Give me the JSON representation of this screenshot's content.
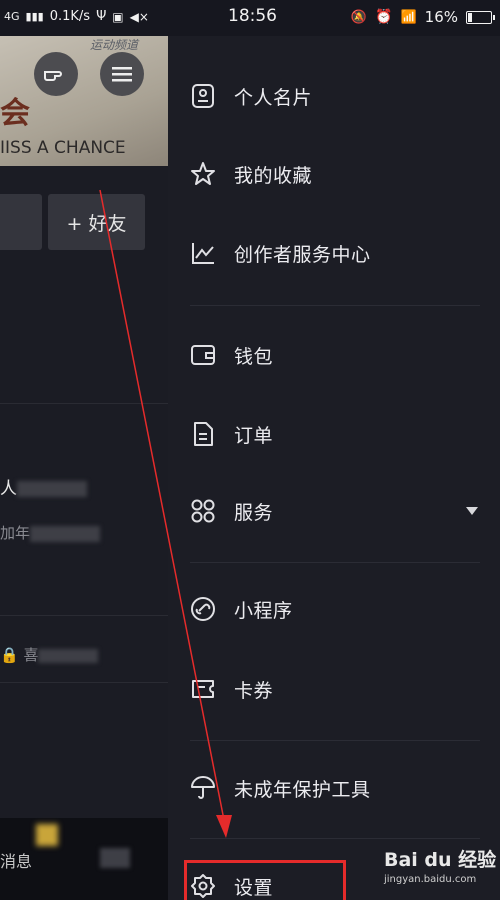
{
  "status_bar": {
    "network": "4G",
    "speed": "0.1K/s",
    "time": "18:56",
    "battery": "16%",
    "battery_level": 0.16
  },
  "left_page": {
    "watermark": "运动频道",
    "big_text": "会",
    "banner_text": "IISS A CHANCE",
    "friend_button": "+ 好友",
    "partial_1": "人",
    "partial_2": "加年",
    "partial_3": "喜",
    "partial_4": "消息"
  },
  "drawer": {
    "items": [
      {
        "label": "个人名片",
        "icon": "id-card-icon"
      },
      {
        "label": "我的收藏",
        "icon": "star-icon"
      },
      {
        "label": "创作者服务中心",
        "icon": "chart-icon"
      },
      {
        "label": "钱包",
        "icon": "wallet-icon"
      },
      {
        "label": "订单",
        "icon": "document-icon"
      },
      {
        "label": "服务",
        "icon": "grid-icon"
      },
      {
        "label": "小程序",
        "icon": "link-icon"
      },
      {
        "label": "卡券",
        "icon": "ticket-icon"
      },
      {
        "label": "未成年保护工具",
        "icon": "umbrella-icon"
      },
      {
        "label": "设置",
        "icon": "gear-icon"
      }
    ]
  },
  "watermark": {
    "logo": "Bai du 经验",
    "site": "jingyan.baidu.com"
  },
  "colors": {
    "drawer_bg": "#1c1d25",
    "highlight": "#e52b2b",
    "text": "#ececf0"
  }
}
